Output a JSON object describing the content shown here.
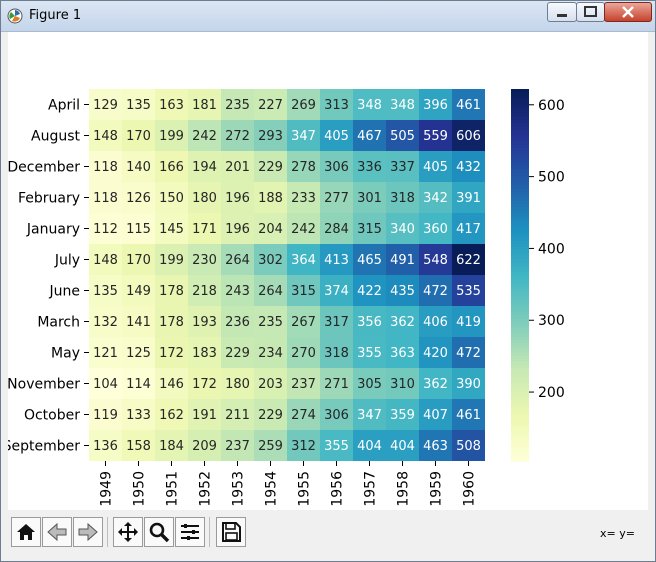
{
  "window": {
    "title": "Figure 1"
  },
  "toolbar": {
    "coords": "x= y="
  },
  "icons": [
    "matplotlib-app-icon",
    "minimize-icon",
    "maximize-icon",
    "close-icon",
    "home-icon",
    "back-icon",
    "forward-icon",
    "pan-icon",
    "zoom-icon",
    "subplots-icon",
    "save-icon"
  ],
  "colors": {
    "cmap_low": "#ffffd9",
    "cmap_high": "#081d58",
    "text_light": "#ffffff",
    "text_dark": "#262626"
  },
  "chart_data": {
    "type": "heatmap",
    "title": "",
    "xlabel": "",
    "ylabel": "",
    "x": [
      "1949",
      "1950",
      "1951",
      "1952",
      "1953",
      "1954",
      "1955",
      "1956",
      "1957",
      "1958",
      "1959",
      "1960"
    ],
    "y": [
      "April",
      "August",
      "December",
      "February",
      "January",
      "July",
      "June",
      "March",
      "May",
      "November",
      "October",
      "September"
    ],
    "values": [
      [
        129,
        135,
        163,
        181,
        235,
        227,
        269,
        313,
        348,
        348,
        396,
        461
      ],
      [
        148,
        170,
        199,
        242,
        272,
        293,
        347,
        405,
        467,
        505,
        559,
        606
      ],
      [
        118,
        140,
        166,
        194,
        201,
        229,
        278,
        306,
        336,
        337,
        405,
        432
      ],
      [
        118,
        126,
        150,
        180,
        196,
        188,
        233,
        277,
        301,
        318,
        342,
        391
      ],
      [
        112,
        115,
        145,
        171,
        196,
        204,
        242,
        284,
        315,
        340,
        360,
        417
      ],
      [
        148,
        170,
        199,
        230,
        264,
        302,
        364,
        413,
        465,
        491,
        548,
        622
      ],
      [
        135,
        149,
        178,
        218,
        243,
        264,
        315,
        374,
        422,
        435,
        472,
        535
      ],
      [
        132,
        141,
        178,
        193,
        236,
        235,
        267,
        317,
        356,
        362,
        406,
        419
      ],
      [
        121,
        125,
        172,
        183,
        229,
        234,
        270,
        318,
        355,
        363,
        420,
        472
      ],
      [
        104,
        114,
        146,
        172,
        180,
        203,
        237,
        271,
        305,
        310,
        362,
        390
      ],
      [
        119,
        133,
        162,
        191,
        211,
        229,
        274,
        306,
        347,
        359,
        407,
        461
      ],
      [
        136,
        158,
        184,
        209,
        237,
        259,
        312,
        355,
        404,
        404,
        463,
        508
      ]
    ],
    "vmin": 104,
    "vmax": 622,
    "colormap": "YlGnBu",
    "annotations": true,
    "colorbar": {
      "ticks": [
        200,
        300,
        400,
        500,
        600
      ]
    },
    "grid": false
  }
}
